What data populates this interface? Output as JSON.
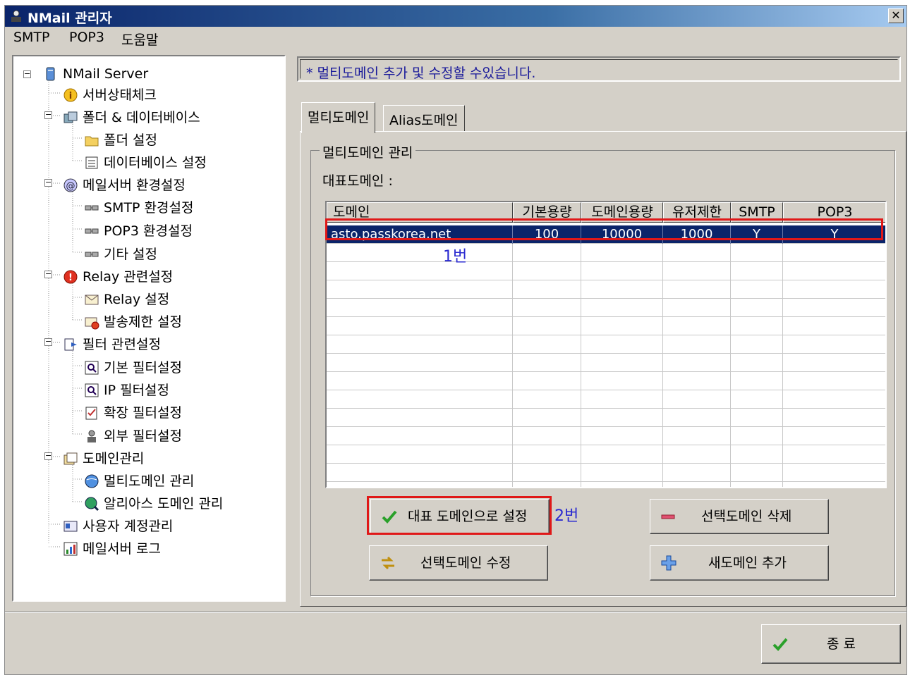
{
  "window": {
    "title": "NMail 관리자",
    "close_label": "✕"
  },
  "menu": [
    "SMTP",
    "POP3",
    "도움말"
  ],
  "tree": {
    "root": "NMail Server",
    "server_check": "서버상태체크",
    "folder_db": "폴더 & 데이터베이스",
    "folder_settings": "폴더 설정",
    "db_settings": "데이터베이스 설정",
    "mailserver_env": "메일서버 환경설정",
    "smtp_env": "SMTP 환경설정",
    "pop3_env": "POP3 환경설정",
    "other_settings": "기타 설정",
    "relay_group": "Relay 관련설정",
    "relay_settings": "Relay 설정",
    "send_limit": "발송제한 설정",
    "filter_group": "필터 관련설정",
    "basic_filter": "기본 필터설정",
    "ip_filter": "IP 필터설정",
    "ext_filter": "확장 필터설정",
    "external_filter": "외부 필터설정",
    "domain_group": "도메인관리",
    "multi_domain": "멀티도메인 관리",
    "alias_domain": "알리아스 도메인 관리",
    "user_accounts": "사용자 계정관리",
    "mail_log": "메일서버 로그"
  },
  "info_text": "* 멀티도메인 추가 및 수정할 수있습니다.",
  "tabs": {
    "multi": "멀티도메인",
    "alias": "Alias도메인"
  },
  "group_title": "멀티도메인 관리",
  "representative_label": "대표도메인 :",
  "table": {
    "headers": [
      "도메인",
      "기본용량",
      "도메인용량",
      "유저제한",
      "SMTP",
      "POP3"
    ],
    "rows": [
      [
        "asto.passkorea.net",
        "100",
        "10000",
        "1000",
        "Y",
        "Y"
      ]
    ]
  },
  "annotations": {
    "note1": "1번",
    "note2": "2번"
  },
  "buttons": {
    "set_representative": "대표 도메인으로 설정",
    "delete_selected": "선택도메인 삭제",
    "edit_selected": "선택도메인 수정",
    "add_new": "새도메인 추가",
    "exit": "종 료"
  },
  "colors": {
    "title_bar": "#0a246a",
    "selection": "#0a246a",
    "highlight_box": "#e01818",
    "annotation_text": "#2a2ad0"
  }
}
